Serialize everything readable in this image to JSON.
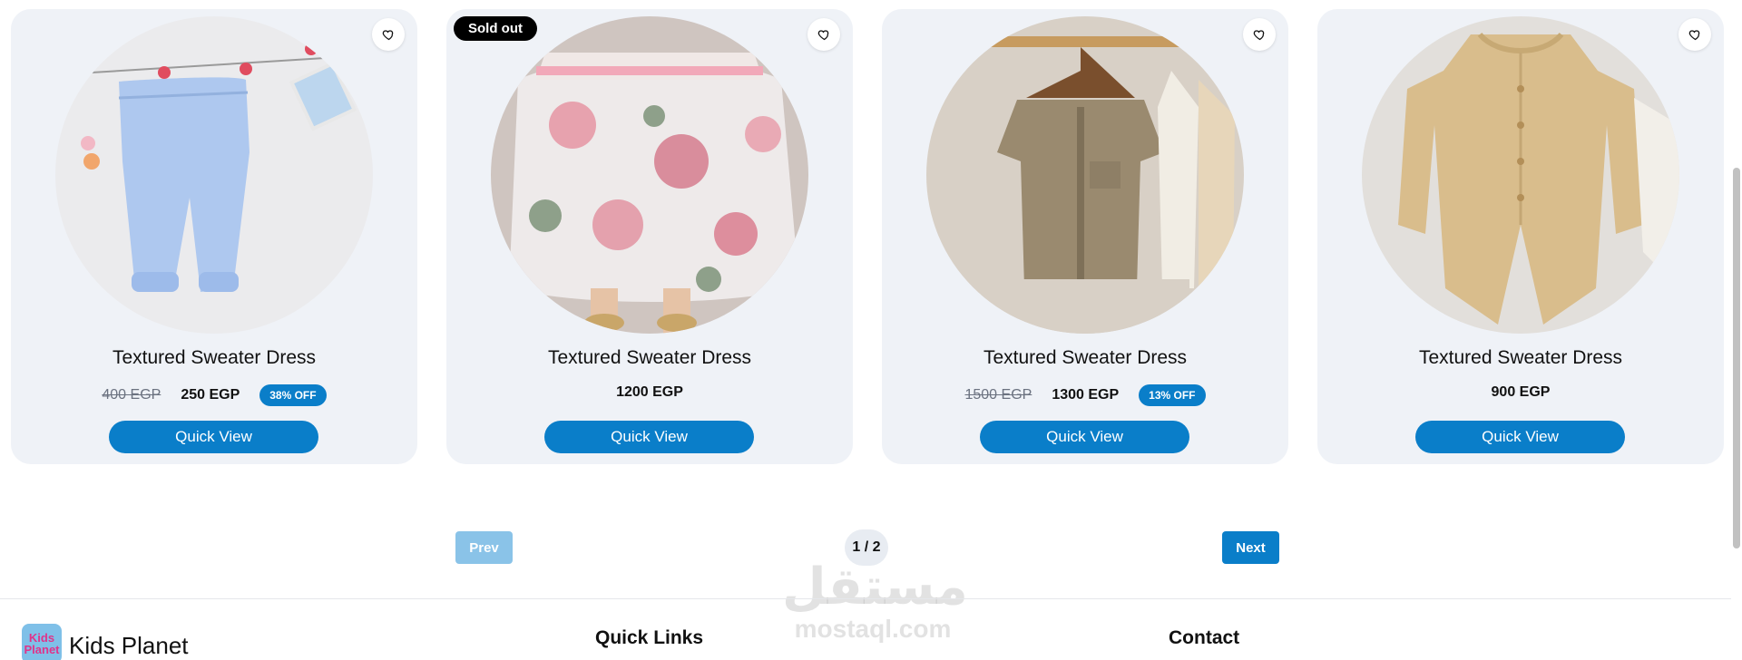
{
  "products": [
    {
      "title": "Textured Sweater Dress",
      "old_price": "400 EGP",
      "price": "250 EGP",
      "discount": "38% OFF",
      "quick_view": "Quick View",
      "image": "light-blue-pants-on-clothesline",
      "sold_out": ""
    },
    {
      "title": "Textured Sweater Dress",
      "old_price": "",
      "price": "1200 EGP",
      "discount": "",
      "quick_view": "Quick View",
      "image": "floral-pink-dress",
      "sold_out": "Sold out"
    },
    {
      "title": "Textured Sweater Dress",
      "old_price": "1500 EGP",
      "price": "1300 EGP",
      "discount": "13% OFF",
      "quick_view": "Quick View",
      "image": "khaki-romper-on-hanger",
      "sold_out": ""
    },
    {
      "title": "Textured Sweater Dress",
      "old_price": "",
      "price": "900 EGP",
      "discount": "",
      "quick_view": "Quick View",
      "image": "beige-knit-romper",
      "sold_out": ""
    }
  ],
  "pagination": {
    "prev": "Prev",
    "indicator": "1 / 2",
    "next": "Next"
  },
  "watermark": {
    "arabic": "مستقل",
    "latin": "mostaql.com"
  },
  "footer": {
    "logo_text": "Kids Planet",
    "brand": "Kids Planet",
    "quick_links": "Quick Links",
    "contact": "Contact"
  },
  "colors": {
    "accent": "#0a7ec9",
    "card_bg": "#eff2f7",
    "prev_disabled": "#8ac3e8",
    "sold_out_bg": "#000000"
  },
  "icons": {
    "wishlist": "heart-icon"
  }
}
